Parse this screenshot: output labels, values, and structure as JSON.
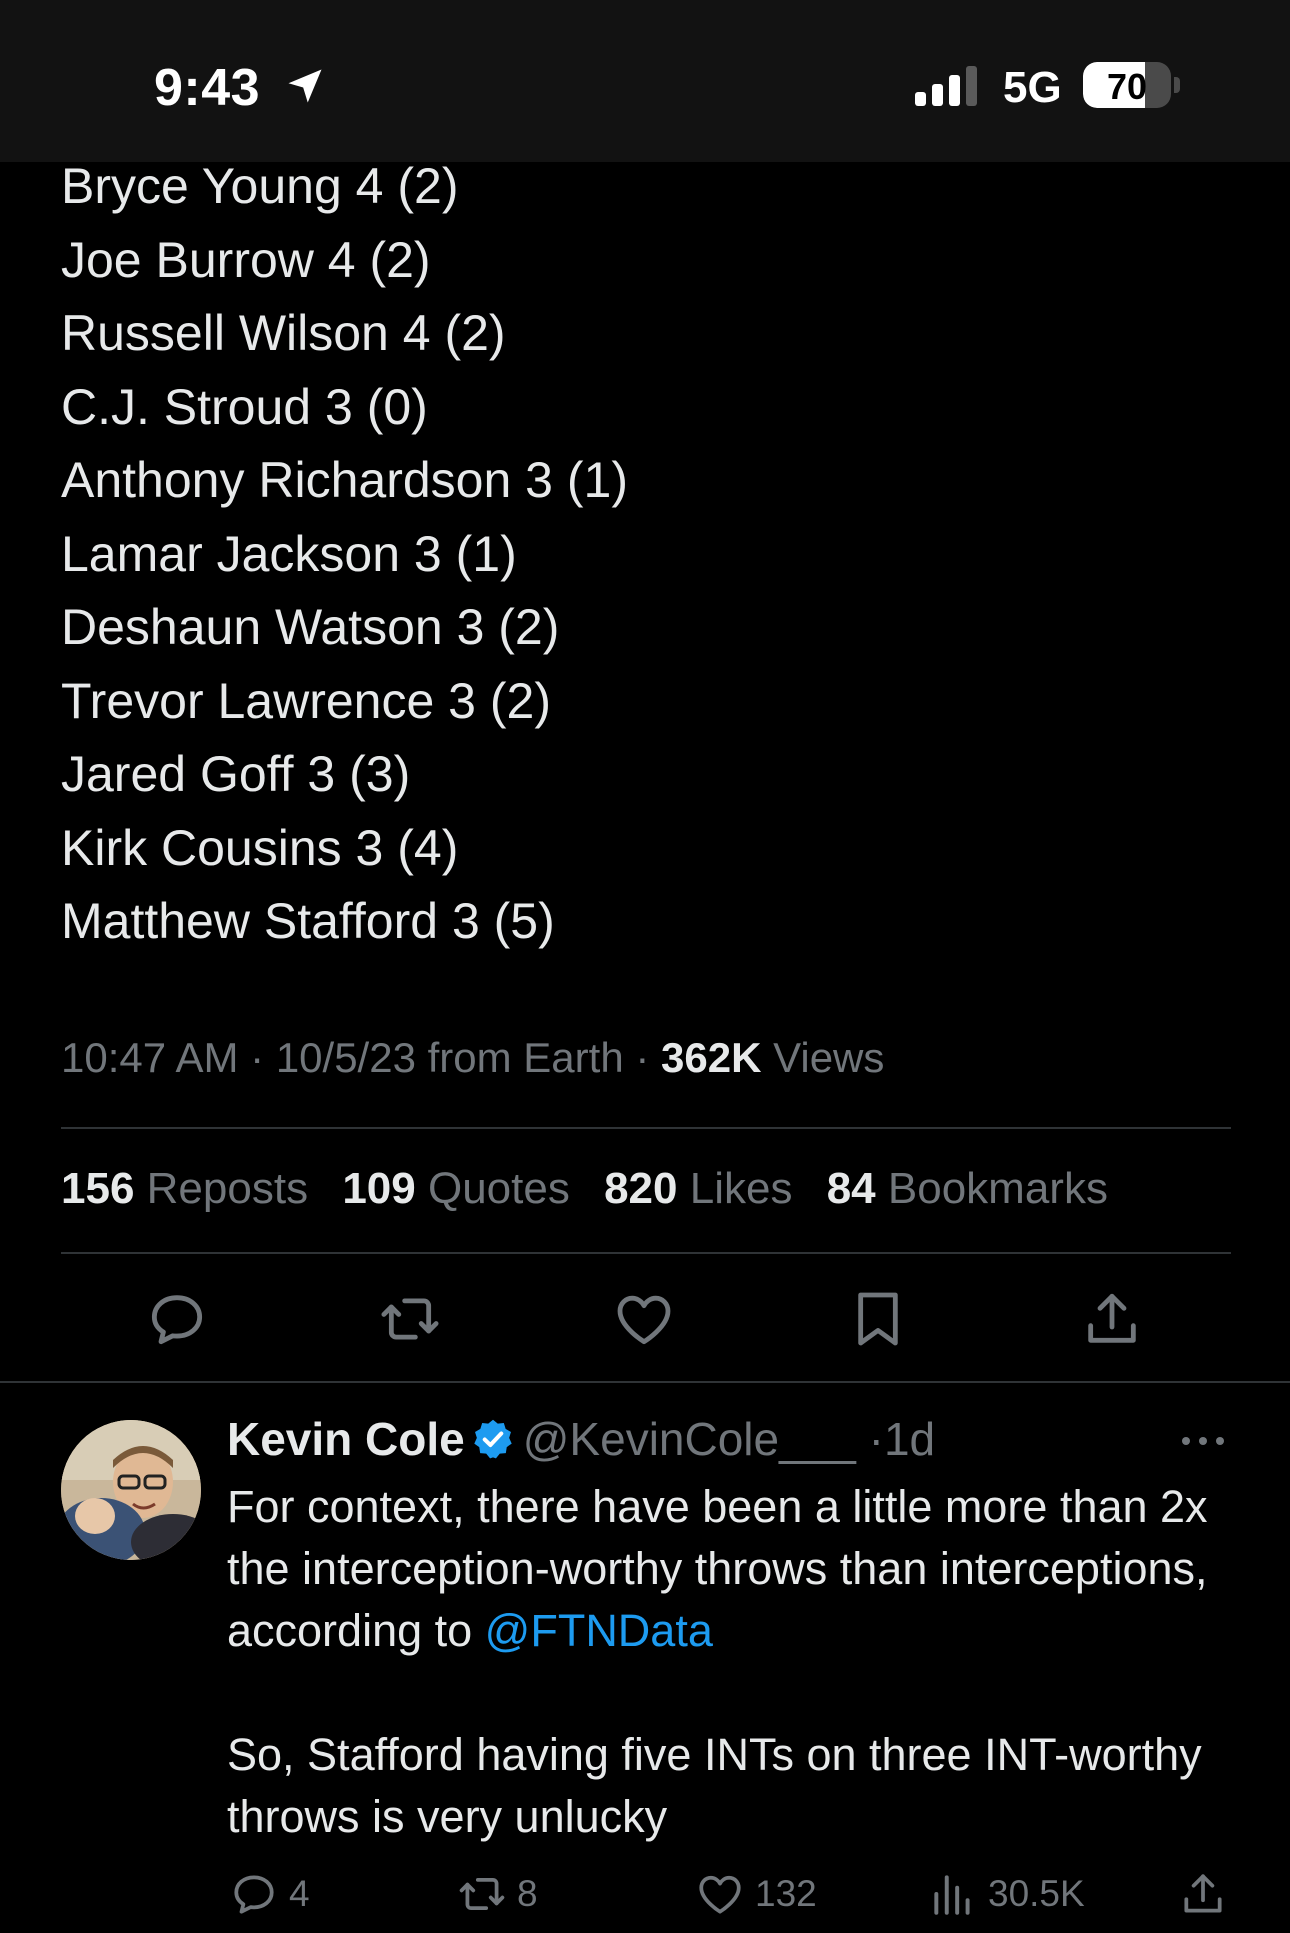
{
  "status_bar": {
    "time": "9:43",
    "network": "5G",
    "battery_level": "70",
    "battery_fraction": 0.7
  },
  "ranking": [
    "Bryce Young 4 (2)",
    "Joe Burrow 4 (2)",
    "Russell Wilson 4 (2)",
    "C.J. Stroud 3 (0)",
    "Anthony Richardson 3 (1)",
    "Lamar Jackson 3 (1)",
    "Deshaun Watson 3 (2)",
    "Trevor Lawrence 3 (2)",
    "Jared Goff 3 (3)",
    "Kirk Cousins 3 (4)",
    "Matthew Stafford 3 (5)"
  ],
  "post": {
    "time": "10:47 AM",
    "date": "10/5/23",
    "source": "from Earth",
    "sep": "·",
    "views_count": "362K",
    "views_label": "Views"
  },
  "engagement": {
    "reposts_count": "156",
    "reposts_label": "Reposts",
    "quotes_count": "109",
    "quotes_label": "Quotes",
    "likes_count": "820",
    "likes_label": "Likes",
    "bookmarks_count": "84",
    "bookmarks_label": "Bookmarks"
  },
  "actions": {
    "icons": [
      "reply-icon",
      "repost-icon",
      "like-icon",
      "bookmark-icon",
      "share-icon"
    ]
  },
  "reply": {
    "author": "Kevin Cole",
    "handle": "@KevinCole___",
    "sep": "·",
    "time": "1d",
    "body_1_pre": "For context, there have been a little more than 2x the interception-worthy throws than interceptions, according to ",
    "mention": "@FTNData",
    "body_2": "So, Stafford having five INTs on three INT-worthy throws is very unlucky",
    "reply_count": "4",
    "repost_count": "8",
    "like_count": "132",
    "view_count": "30.5K"
  },
  "colors": {
    "background": "#000000",
    "status_bar": "#121212",
    "text": "#e7e9ea",
    "muted": "#71767b",
    "accent": "#1d9bf0",
    "divider": "#2f3336"
  }
}
